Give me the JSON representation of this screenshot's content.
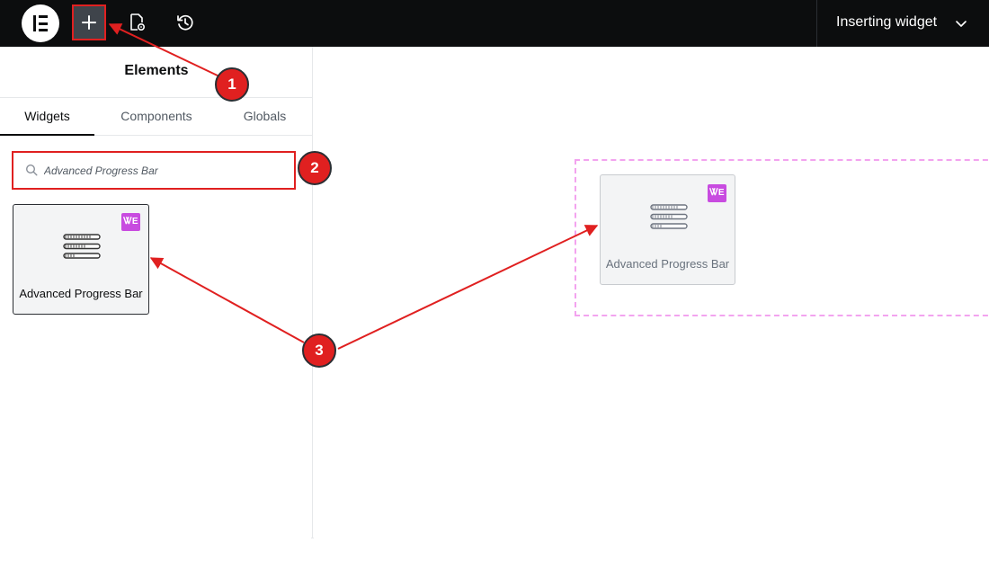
{
  "topbar": {
    "logo_icon": "elementor-logo-icon",
    "add_button_icon": "plus-icon",
    "page_settings_icon": "page-settings-icon",
    "history_icon": "history-icon",
    "title": "Inserting widget",
    "chevron_icon": "chevron-down-icon"
  },
  "sidebar": {
    "title": "Elements",
    "tabs": [
      {
        "label": "Widgets",
        "active": true
      },
      {
        "label": "Components",
        "active": false
      },
      {
        "label": "Globals",
        "active": false
      }
    ],
    "search": {
      "value": "Advanced Progress Bar",
      "icon": "search-icon"
    },
    "widget": {
      "label": "Advanced Progress Bar",
      "icon": "progress-bars-icon",
      "badge": "ᏔE"
    },
    "collapse_icon": "chevron-left-icon"
  },
  "canvas": {
    "preview_widget": {
      "label": "Advanced Progress Bar",
      "icon": "progress-bars-icon",
      "badge": "ᏔE"
    }
  },
  "annotations": {
    "markers": [
      "1",
      "2",
      "3"
    ],
    "color": "#e02020"
  },
  "colors": {
    "topbar_bg": "#0c0d0e",
    "accent_red": "#e02020",
    "dropzone_border": "#f3a3ef",
    "pro_badge": "#c84be0"
  }
}
